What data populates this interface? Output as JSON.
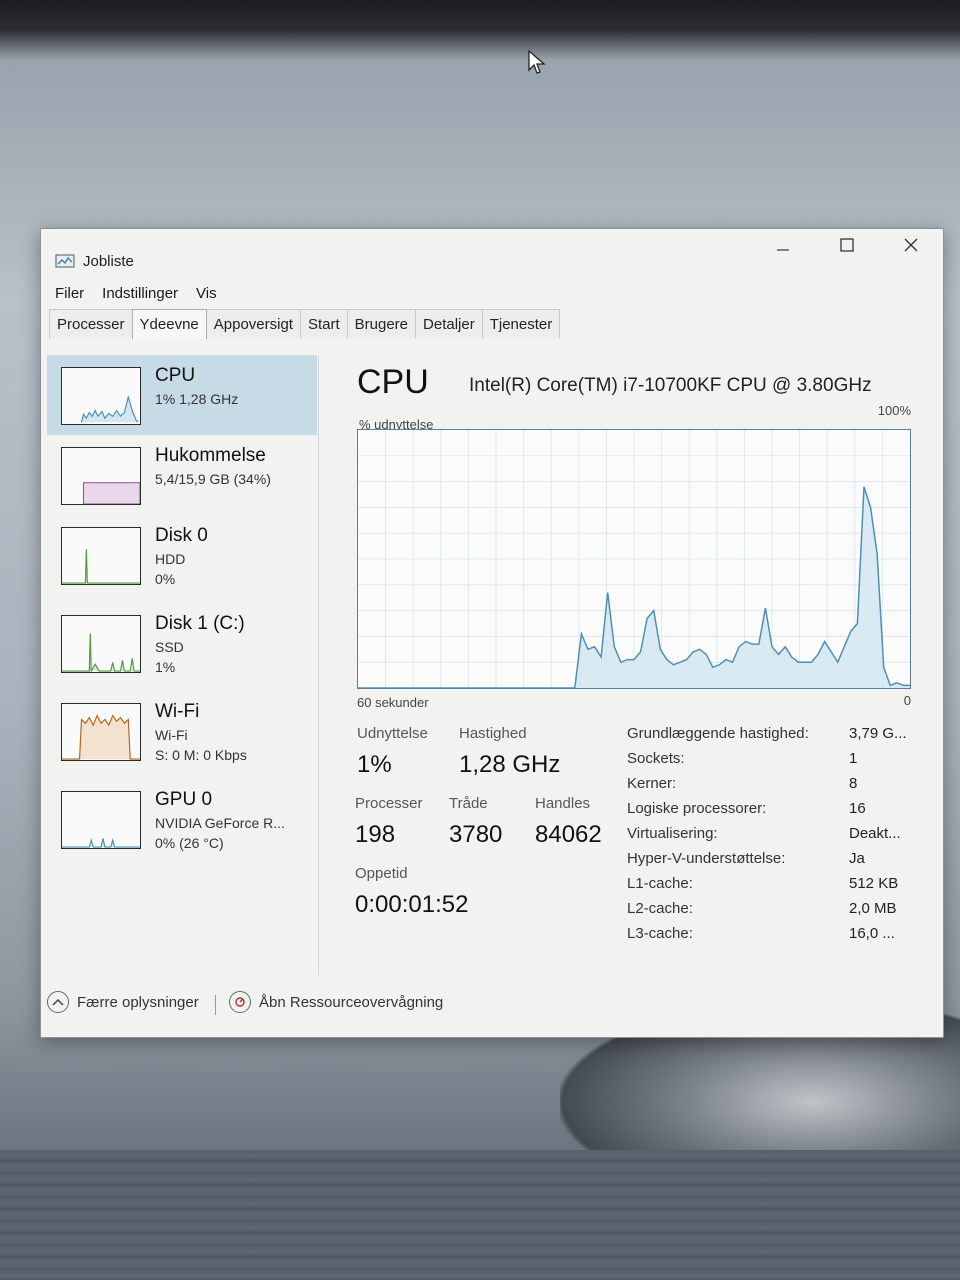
{
  "window": {
    "title": "Jobliste"
  },
  "menu": [
    "Filer",
    "Indstillinger",
    "Vis"
  ],
  "tabs": [
    "Processer",
    "Ydeevne",
    "Appoversigt",
    "Start",
    "Brugere",
    "Detaljer",
    "Tjenester"
  ],
  "active_tab": "Ydeevne",
  "sidebar": {
    "items": [
      {
        "name": "CPU",
        "sub1": "1% 1,28 GHz",
        "sub2": ""
      },
      {
        "name": "Hukommelse",
        "sub1": "5,4/15,9 GB (34%)",
        "sub2": ""
      },
      {
        "name": "Disk 0",
        "sub1": "HDD",
        "sub2": "0%"
      },
      {
        "name": "Disk 1 (C:)",
        "sub1": "SSD",
        "sub2": "1%"
      },
      {
        "name": "Wi-Fi",
        "sub1": "Wi-Fi",
        "sub2": "S: 0 M: 0 Kbps"
      },
      {
        "name": "GPU 0",
        "sub1": "NVIDIA GeForce R...",
        "sub2": "0% (26 °C)"
      }
    ]
  },
  "main": {
    "title": "CPU",
    "model": "Intel(R) Core(TM) i7-10700KF CPU @ 3.80GHz",
    "graph_label": "% udnyttelse",
    "graph_max": "100%",
    "graph_time": "60 sekunder",
    "graph_min": "0",
    "stats": {
      "util_label": "Udnyttelse",
      "util_value": "1%",
      "speed_label": "Hastighed",
      "speed_value": "1,28 GHz",
      "proc_label": "Processer",
      "proc_value": "198",
      "threads_label": "Tråde",
      "threads_value": "3780",
      "handles_label": "Handles",
      "handles_value": "84062",
      "uptime_label": "Oppetid",
      "uptime_value": "0:00:01:52"
    },
    "props": [
      {
        "key": "Grundlæggende hastighed:",
        "value": "3,79 G..."
      },
      {
        "key": "Sockets:",
        "value": "1"
      },
      {
        "key": "Kerner:",
        "value": "8"
      },
      {
        "key": "Logiske processorer:",
        "value": "16"
      },
      {
        "key": "Virtualisering:",
        "value": "Deakt..."
      },
      {
        "key": "Hyper-V-understøttelse:",
        "value": "Ja"
      },
      {
        "key": "L1-cache:",
        "value": "512 KB"
      },
      {
        "key": "L2-cache:",
        "value": "2,0 MB"
      },
      {
        "key": "L3-cache:",
        "value": "16,0 ..."
      }
    ]
  },
  "footer": {
    "fewer_details": "Færre oplysninger",
    "open_monitor": "Åbn Ressourceovervågning"
  },
  "chart_data": {
    "type": "area",
    "ylim": [
      0,
      100
    ],
    "xlabel": "60 sekunder",
    "ylabel": "% udnyttelse",
    "values": [
      0,
      0,
      0,
      0,
      0,
      0,
      0,
      0,
      0,
      0,
      0,
      0,
      0,
      0,
      0,
      0,
      0,
      0,
      0,
      0,
      0,
      0,
      0,
      0,
      0,
      0,
      0,
      0,
      0,
      0,
      0,
      0,
      0,
      0,
      21,
      15,
      16,
      12,
      37,
      16,
      10,
      11,
      11,
      14,
      27,
      30,
      15,
      11,
      9,
      10,
      11,
      14,
      15,
      13,
      8,
      9,
      11,
      10,
      16,
      18,
      17,
      17,
      31,
      16,
      13,
      16,
      12,
      10,
      10,
      10,
      13,
      18,
      14,
      10,
      16,
      22,
      25,
      78,
      70,
      52,
      8,
      1,
      2,
      1,
      1
    ]
  },
  "colors": {
    "graph_line": "#4e8fb4",
    "graph_fill": "#d3e6f1",
    "selected_item": "#c6dbe6",
    "disk_line": "#4f9a3e",
    "wifi_line": "#b5651d",
    "grid": "#dfe8ee"
  }
}
